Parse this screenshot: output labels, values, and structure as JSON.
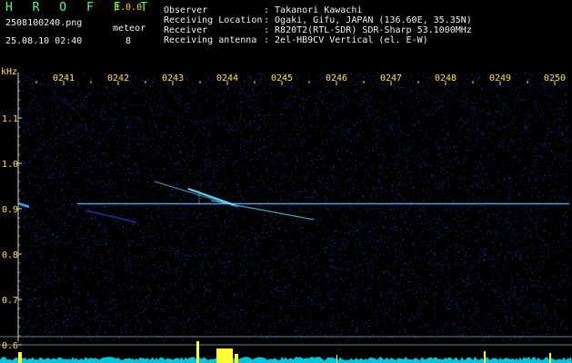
{
  "app": {
    "logo": "H R O F F T",
    "version": "1.0.0"
  },
  "file": {
    "name": "2508100240.png",
    "datetime": "25.08.10 02:40"
  },
  "meteor": {
    "label": "meteor",
    "count": "8"
  },
  "info": [
    {
      "key": "Observer",
      "value": ": Takanori Kawachi"
    },
    {
      "key": "Receiving Location",
      "value": ": Ogaki, Gifu, JAPAN (136.60E, 35.35N)"
    },
    {
      "key": "Receiver",
      "value": ": R820T2(RTL-SDR) SDR-Sharp 53.1000MHz"
    },
    {
      "key": "Receiving antenna",
      "value": ": 2el-HB9CV Vertical (el. E-W)"
    }
  ],
  "axes": {
    "y_unit": "kHz",
    "y_ticks": [
      "1.1",
      "1.0",
      "0.9",
      "0.8",
      "0.7",
      "0.6"
    ],
    "x_ticks": [
      "0241",
      "0242",
      "0243",
      "0244",
      "0245",
      "0246",
      "0247",
      "0248",
      "0249",
      "0250"
    ]
  },
  "colors": {
    "background": "#000000",
    "noise": "#1a2a8a",
    "carrier": "#4aa8ff",
    "meteor": "#69d9ff",
    "signal_bars": "#ffff33",
    "baseline": "#00e6ff"
  }
}
